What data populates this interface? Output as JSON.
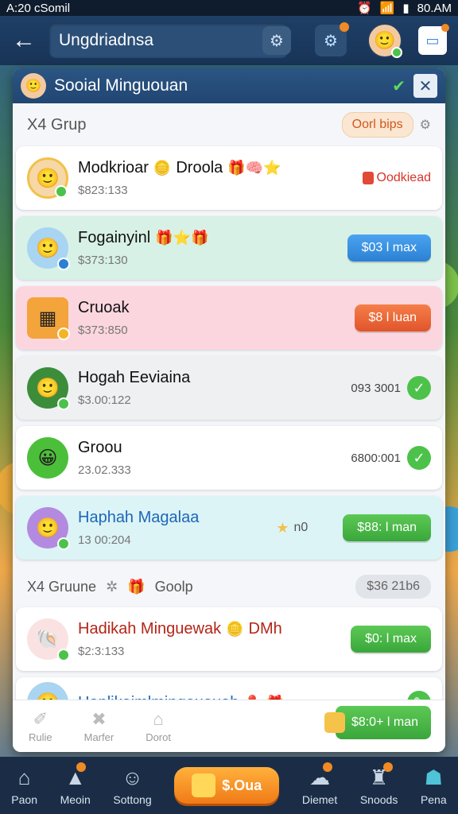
{
  "status_bar": {
    "time": "A:20 cSomil",
    "clock": "80.AM"
  },
  "topbar": {
    "search_value": "Ungdriadnsa"
  },
  "panel": {
    "title": "Sooial Minguouan",
    "section1": {
      "label": "X4 Grup",
      "pill": "Oorl bips"
    },
    "rows1": [
      {
        "name": "Modkrioar",
        "name_extra": "Droola",
        "sub": "$823:133",
        "tag": "Oodkiead",
        "style": "white"
      },
      {
        "name": "Fogainyinl",
        "sub": "$373:130",
        "button": "$03 l max",
        "style": "green"
      },
      {
        "name": "Cruoak",
        "sub": "$373:850",
        "button": "$8 l luan",
        "style": "pink"
      },
      {
        "name": "Hogah Eeviaina",
        "sub": "$3.00:122",
        "status": "093 3001",
        "style": "gray"
      },
      {
        "name": "Groou",
        "sub": "23.02.333",
        "status": "6800:001",
        "style": "white"
      },
      {
        "name": "Haphah Magalaa",
        "sub": "13 00:204",
        "star_text": "n0",
        "button": "$88: l man",
        "style": "cyan"
      }
    ],
    "section2": {
      "label": "X4 Gruune",
      "label2": "Goolp",
      "amount": "$36 21b6"
    },
    "rows2": [
      {
        "name": "Hadikah Minguewak",
        "name_extra": "DMh",
        "sub": "$2:3:133",
        "button": "$0: l max",
        "style": "white"
      },
      {
        "name": "Haplikaimlmingouauah",
        "sub": "",
        "style": "white"
      }
    ],
    "tools": [
      {
        "label": "Rulie"
      },
      {
        "label": "Marfer"
      },
      {
        "label": "Dorot"
      }
    ],
    "bottom_button": "$8:0+ l man"
  },
  "navbar": {
    "items": [
      {
        "label": "Paon"
      },
      {
        "label": "Meoin"
      },
      {
        "label": "Sottong"
      },
      {
        "label": "Diemet"
      },
      {
        "label": "Snoods"
      },
      {
        "label": "Pena"
      }
    ],
    "center": "$.Oua"
  },
  "colors": {
    "topbar": "#1f3f66",
    "accent_green": "#3aa63b",
    "accent_blue": "#2c80d3",
    "accent_orange": "#e0542a"
  }
}
